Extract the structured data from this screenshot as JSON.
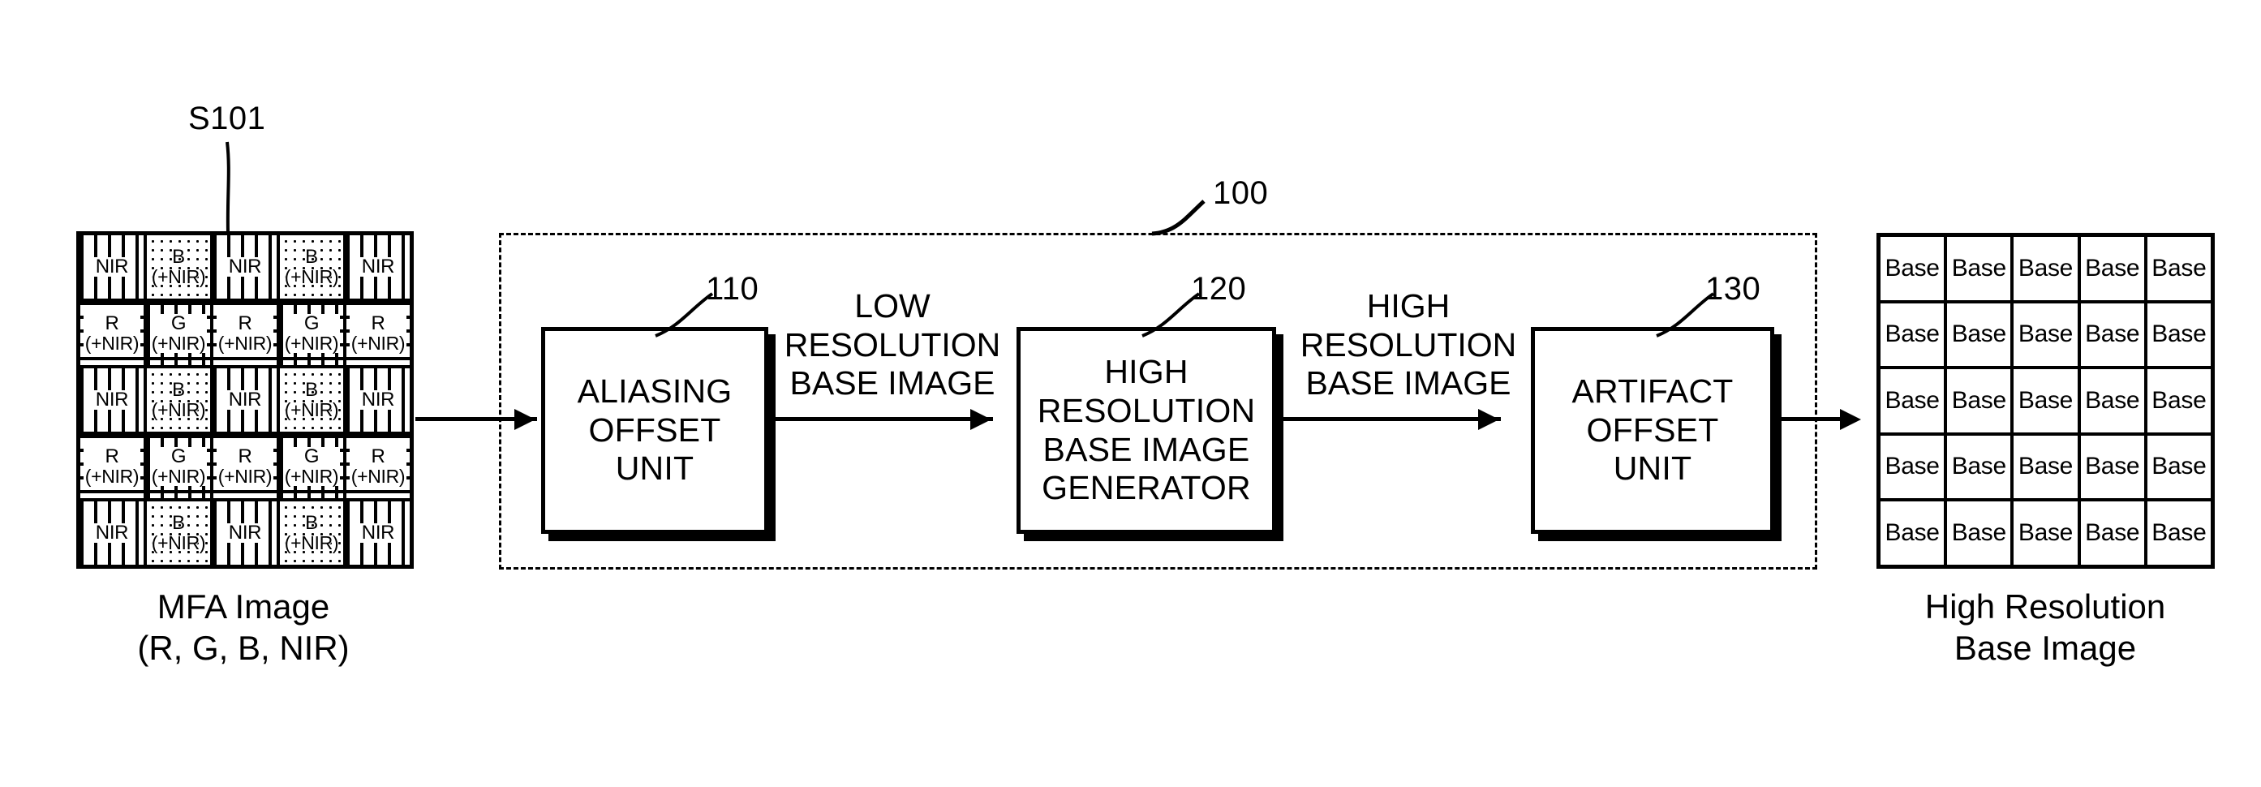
{
  "figure": {
    "step_label": "S101",
    "system_ref": "100"
  },
  "mfa_image": {
    "caption_line1": "MFA Image",
    "caption_line2": "(R, G, B, NIR)",
    "rows": 5,
    "cols": 5,
    "cells": [
      [
        {
          "label": "NIR",
          "sub": "",
          "pattern": "vert"
        },
        {
          "label": "B",
          "sub": "(+NIR)",
          "pattern": "dots"
        },
        {
          "label": "NIR",
          "sub": "",
          "pattern": "vert"
        },
        {
          "label": "B",
          "sub": "(+NIR)",
          "pattern": "dots"
        },
        {
          "label": "NIR",
          "sub": "",
          "pattern": "vert"
        }
      ],
      [
        {
          "label": "R",
          "sub": "(+NIR)",
          "pattern": "horz"
        },
        {
          "label": "G",
          "sub": "(+NIR)",
          "pattern": "cross"
        },
        {
          "label": "R",
          "sub": "(+NIR)",
          "pattern": "horz"
        },
        {
          "label": "G",
          "sub": "(+NIR)",
          "pattern": "cross"
        },
        {
          "label": "R",
          "sub": "(+NIR)",
          "pattern": "horz"
        }
      ],
      [
        {
          "label": "NIR",
          "sub": "",
          "pattern": "vert"
        },
        {
          "label": "B",
          "sub": "(+NIR)",
          "pattern": "dots"
        },
        {
          "label": "NIR",
          "sub": "",
          "pattern": "vert"
        },
        {
          "label": "B",
          "sub": "(+NIR)",
          "pattern": "dots"
        },
        {
          "label": "NIR",
          "sub": "",
          "pattern": "vert"
        }
      ],
      [
        {
          "label": "R",
          "sub": "(+NIR)",
          "pattern": "horz"
        },
        {
          "label": "G",
          "sub": "(+NIR)",
          "pattern": "cross"
        },
        {
          "label": "R",
          "sub": "(+NIR)",
          "pattern": "horz"
        },
        {
          "label": "G",
          "sub": "(+NIR)",
          "pattern": "cross"
        },
        {
          "label": "R",
          "sub": "(+NIR)",
          "pattern": "horz"
        }
      ],
      [
        {
          "label": "NIR",
          "sub": "",
          "pattern": "vert"
        },
        {
          "label": "B",
          "sub": "(+NIR)",
          "pattern": "dots"
        },
        {
          "label": "NIR",
          "sub": "",
          "pattern": "vert"
        },
        {
          "label": "B",
          "sub": "(+NIR)",
          "pattern": "dots"
        },
        {
          "label": "NIR",
          "sub": "",
          "pattern": "vert"
        }
      ]
    ]
  },
  "blocks": [
    {
      "ref": "110",
      "name": "aliasing-offset-unit",
      "lines": [
        "ALIASING",
        "OFFSET",
        "UNIT"
      ]
    },
    {
      "ref": "120",
      "name": "high-resolution-base-image-generator",
      "lines": [
        "HIGH",
        "RESOLUTION",
        "BASE IMAGE",
        "GENERATOR"
      ]
    },
    {
      "ref": "130",
      "name": "artifact-offset-unit",
      "lines": [
        "ARTIFACT",
        "OFFSET",
        "UNIT"
      ]
    }
  ],
  "flows": [
    {
      "name": "low-resolution-base-image",
      "lines": [
        "LOW",
        "RESOLUTION",
        "BASE IMAGE"
      ]
    },
    {
      "name": "high-resolution-base-image",
      "lines": [
        "HIGH",
        "RESOLUTION",
        "BASE IMAGE"
      ]
    }
  ],
  "output_image": {
    "caption_line1": "High Resolution",
    "caption_line2": "Base Image",
    "rows": 5,
    "cols": 5,
    "cell_label": "Base"
  },
  "colors": {
    "ink": "#000000",
    "paper": "#ffffff"
  }
}
